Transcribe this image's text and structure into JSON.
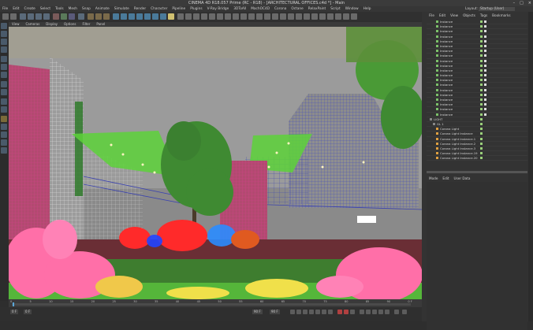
{
  "window": {
    "title": "CINEMA 4D R18.057 Prime (RC - R18) - [ARCHITECTURAL OFFICES.c4d *] - Main",
    "controls": [
      "–",
      "□",
      "×"
    ]
  },
  "menubar": [
    "File",
    "Edit",
    "Create",
    "Select",
    "Tools",
    "Mesh",
    "Snap",
    "Animate",
    "Simulate",
    "Render",
    "Character",
    "Pipeline",
    "Plugins",
    "V-Ray Bridge",
    "3DToAll",
    "MachOC4D",
    "Corona",
    "Octane",
    "RelaxPaint",
    "Script",
    "Window",
    "Help"
  ],
  "layout": {
    "label": "Layout:",
    "value": "Startup (User)"
  },
  "viewport_menu": [
    "View",
    "Cameras",
    "Display",
    "Options",
    "Filter",
    "Panel"
  ],
  "objects_panel": {
    "tabs": [
      "File",
      "Edit",
      "View",
      "Objects",
      "Tags",
      "Bookmarks"
    ],
    "rows": [
      {
        "name": "Instance",
        "type": "instance"
      },
      {
        "name": "Instance",
        "type": "instance"
      },
      {
        "name": "Instance",
        "type": "instance"
      },
      {
        "name": "Instance",
        "type": "instance"
      },
      {
        "name": "Instance",
        "type": "instance"
      },
      {
        "name": "Instance",
        "type": "instance"
      },
      {
        "name": "Instance",
        "type": "instance"
      },
      {
        "name": "Instance",
        "type": "instance"
      },
      {
        "name": "Instance",
        "type": "instance"
      },
      {
        "name": "Instance",
        "type": "instance"
      },
      {
        "name": "Instance",
        "type": "instance"
      },
      {
        "name": "Instance",
        "type": "instance"
      },
      {
        "name": "Instance",
        "type": "instance"
      },
      {
        "name": "Instance",
        "type": "instance"
      },
      {
        "name": "Instance",
        "type": "instance"
      },
      {
        "name": "Instance",
        "type": "instance"
      },
      {
        "name": "Instance",
        "type": "instance"
      },
      {
        "name": "Instance",
        "type": "instance"
      },
      {
        "name": "Instance",
        "type": "instance"
      },
      {
        "name": "Instance",
        "type": "instance"
      },
      {
        "name": "LIGHT",
        "type": "group"
      },
      {
        "name": "GL 1",
        "type": "group"
      },
      {
        "name": "Corona Light",
        "type": "light"
      },
      {
        "name": "Corona Light Instance",
        "type": "light"
      },
      {
        "name": "Corona Light Instance.1",
        "type": "light"
      },
      {
        "name": "Corona Light Instance.2",
        "type": "light"
      },
      {
        "name": "Corona Light Instance.3",
        "type": "light"
      },
      {
        "name": "Corona Light Instance.19",
        "type": "light"
      },
      {
        "name": "Corona Light Instance.20",
        "type": "light"
      }
    ]
  },
  "attributes_panel": {
    "tabs": [
      "Mode",
      "Edit",
      "User Data"
    ]
  },
  "timeline": {
    "ticks": [
      "0",
      "5",
      "10",
      "15",
      "20",
      "25",
      "30",
      "35",
      "40",
      "45",
      "50",
      "55",
      "60",
      "65",
      "70",
      "75",
      "80",
      "85",
      "90"
    ],
    "end_label": "0 F"
  },
  "controls": {
    "start_frame": "0 F",
    "min_field": "0 F",
    "max_field": "90 F",
    "end_field": "90 F"
  },
  "colors": {
    "wire_red": "#b0306a",
    "wire_blue": "#3a42b0",
    "wire_white": "#e6e6e6",
    "foliage": "#3f8a32",
    "glass": "#5dd23a",
    "flowers": "#ff5fa0"
  }
}
